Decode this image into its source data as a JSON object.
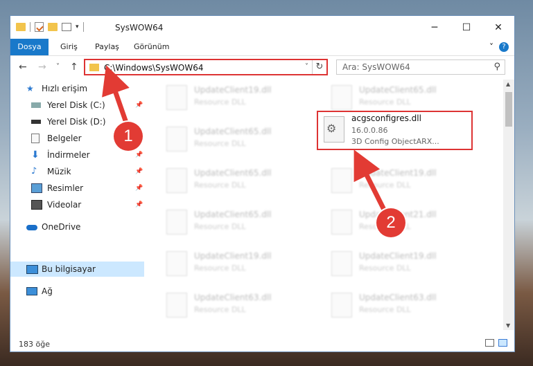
{
  "window": {
    "title": "SysWOW64",
    "controls": {
      "minimize": "─",
      "maximize": "☐",
      "close": "✕"
    }
  },
  "ribbon": {
    "tabs": [
      "Dosya",
      "Giriş",
      "Paylaş",
      "Görünüm"
    ],
    "expand_icon": "˅",
    "help": "?"
  },
  "nav": {
    "back": "←",
    "forward": "→",
    "recent": "˅",
    "up": "↑",
    "address": "C:\\Windows\\SysWOW64",
    "address_dropdown": "˅",
    "refresh": "↻",
    "search_placeholder": "Ara: SysWOW64",
    "search_icon": "⚲"
  },
  "sidebar": {
    "items": [
      {
        "label": "Hızlı erişim",
        "icon": "star-icon",
        "pinned": false
      },
      {
        "label": "Yerel Disk (C:)",
        "icon": "drive-icon",
        "pinned": true
      },
      {
        "label": "Yerel Disk (D:)",
        "icon": "drive-icon",
        "pinned": true
      },
      {
        "label": "Belgeler",
        "icon": "documents-icon",
        "pinned": true
      },
      {
        "label": "İndirmeler",
        "icon": "download-icon",
        "pinned": true
      },
      {
        "label": "Müzik",
        "icon": "music-icon",
        "pinned": true
      },
      {
        "label": "Resimler",
        "icon": "pictures-icon",
        "pinned": true
      },
      {
        "label": "Videolar",
        "icon": "video-icon",
        "pinned": true
      },
      {
        "label": "OneDrive",
        "icon": "cloud-icon",
        "pinned": false
      },
      {
        "label": "Bu bilgisayar",
        "icon": "computer-icon",
        "pinned": false,
        "selected": true
      },
      {
        "label": "Ağ",
        "icon": "network-icon",
        "pinned": false
      }
    ]
  },
  "files": {
    "left_column": [
      {
        "name": "UpdateClient19.dll",
        "type": "Resource DLL"
      },
      {
        "name": "UpdateClient65.dll",
        "type": "Resource DLL"
      },
      {
        "name": "UpdateClient65.dll",
        "type": "Resource DLL"
      },
      {
        "name": "UpdateClient65.dll",
        "type": "Resource DLL"
      },
      {
        "name": "UpdateClient19.dll",
        "type": "Resource DLL"
      },
      {
        "name": "UpdateClient63.dll",
        "type": "Resource DLL"
      }
    ],
    "right_column": [
      {
        "name": "UpdateClient65.dll",
        "type": "Resource DLL"
      },
      null,
      {
        "name": "UpdateClient19.dll",
        "type": "Resource DLL"
      },
      {
        "name": "UpdateClient21.dll",
        "type": "Resource DLL"
      },
      {
        "name": "UpdateClient19.dll",
        "type": "Resource DLL"
      },
      {
        "name": "UpdateClient63.dll",
        "type": "Resource DLL"
      }
    ],
    "highlighted": {
      "name": "acgsconfigres.dll",
      "version": "16.0.0.86",
      "description": "3D Config ObjectARX..."
    }
  },
  "status": {
    "count": "183 öğe"
  },
  "annotations": {
    "step1": "1",
    "step2": "2",
    "color": "#e23b34"
  }
}
